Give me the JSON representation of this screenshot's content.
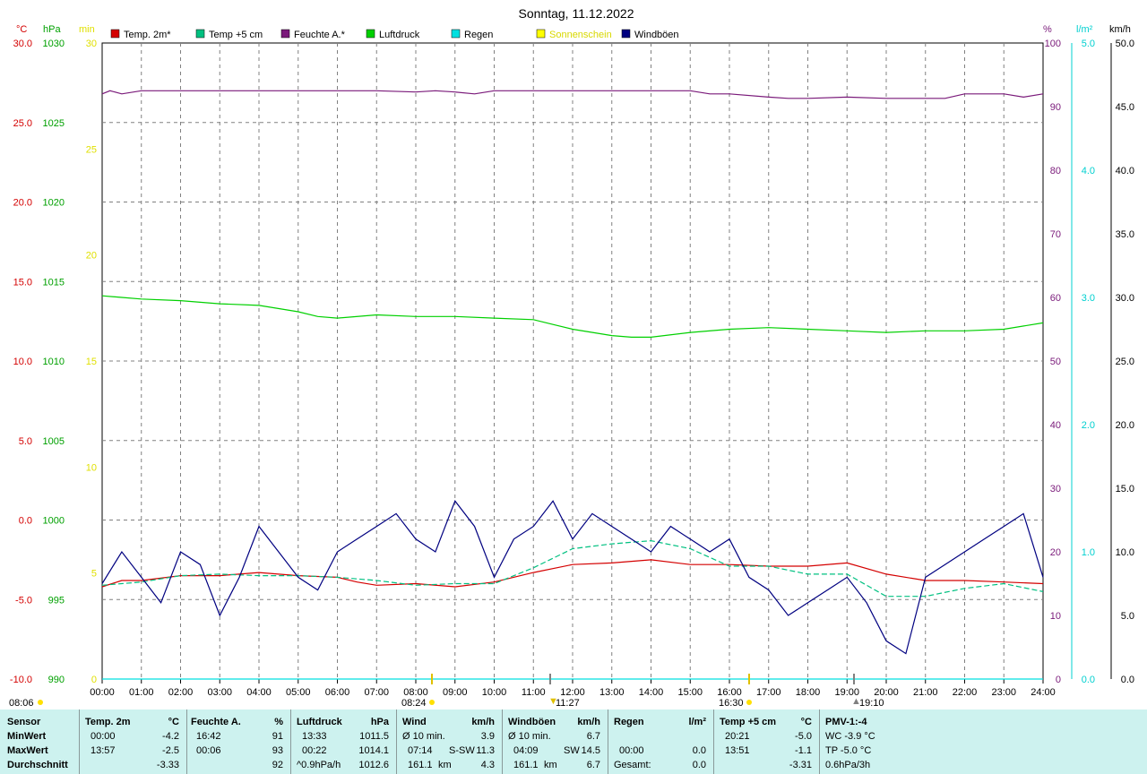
{
  "title": "Sonntag, 11.12.2022",
  "colors": {
    "temp2m": "#d40000",
    "temp5cm": "#00c080",
    "feuchte": "#7a1a7a",
    "luftdruck": "#00d000",
    "regen": "#00e0e0",
    "sonnenschein": "#ffff00",
    "windboeen": "#000080",
    "grid": "#808080",
    "panel": "#cdf2ef"
  },
  "axes": {
    "left_temp": {
      "unit": "°C",
      "ticks": [
        "30.0",
        "25.0",
        "20.0",
        "15.0",
        "10.0",
        "5.0",
        "0.0",
        "-5.0",
        "-10.0"
      ],
      "min": -10,
      "max": 30
    },
    "left_hpa": {
      "unit": "hPa",
      "ticks": [
        "1030",
        "1025",
        "1020",
        "1015",
        "1010",
        "1005",
        "1000",
        "995",
        "990"
      ],
      "min": 990,
      "max": 1030
    },
    "left_min": {
      "unit": "min",
      "ticks": [
        "30",
        "25",
        "20",
        "15",
        "10",
        "5",
        "0"
      ],
      "min": 0,
      "max": 30
    },
    "right_pct": {
      "unit": "%",
      "ticks": [
        "100",
        "90",
        "80",
        "70",
        "60",
        "50",
        "40",
        "30",
        "20",
        "10",
        "0"
      ],
      "min": 0,
      "max": 100
    },
    "right_rain": {
      "unit": "l/m²",
      "ticks": [
        "5.0",
        "4.0",
        "3.0",
        "2.0",
        "1.0",
        "0.0"
      ],
      "min": 0,
      "max": 5
    },
    "right_wind": {
      "unit": "km/h",
      "ticks": [
        "50.0",
        "45.0",
        "40.0",
        "35.0",
        "30.0",
        "25.0",
        "20.0",
        "15.0",
        "10.0",
        "5.0",
        "0.0"
      ],
      "min": 0,
      "max": 50
    },
    "x_ticks": [
      "00:00",
      "01:00",
      "02:00",
      "03:00",
      "04:00",
      "05:00",
      "06:00",
      "07:00",
      "08:00",
      "09:00",
      "10:00",
      "11:00",
      "12:00",
      "13:00",
      "14:00",
      "15:00",
      "16:00",
      "17:00",
      "18:00",
      "19:00",
      "20:00",
      "21:00",
      "22:00",
      "23:00",
      "24:00"
    ]
  },
  "legend": [
    {
      "label": "Temp. 2m*",
      "color": "#d40000"
    },
    {
      "label": "Temp +5 cm",
      "color": "#00c080"
    },
    {
      "label": "Feuchte A.*",
      "color": "#7a1a7a"
    },
    {
      "label": "Luftdruck",
      "color": "#00d000"
    },
    {
      "label": "Regen",
      "color": "#00e0e0"
    },
    {
      "label": "Sonnenschein",
      "color": "#ffff00"
    },
    {
      "label": "Windböen",
      "color": "#000080"
    }
  ],
  "sun_labels": {
    "sunrise_bottom": "08:06",
    "sunrise": "08:24",
    "noon": "11:27",
    "sunset": "16:30",
    "moon": "19:10"
  },
  "chart_data": {
    "type": "line",
    "title": "Sonntag, 11.12.2022",
    "x_unit": "hours",
    "xlim": [
      0,
      24
    ],
    "series": [
      {
        "name": "Temp. 2m*",
        "axis": "°C",
        "x": [
          0,
          0.5,
          1,
          2,
          3,
          4,
          5,
          6,
          6.5,
          7,
          8,
          9,
          10,
          11,
          12,
          13,
          14,
          15,
          16,
          17,
          18,
          19,
          20,
          21,
          22,
          23,
          24
        ],
        "values": [
          -4.2,
          -3.8,
          -3.8,
          -3.5,
          -3.5,
          -3.3,
          -3.5,
          -3.6,
          -3.9,
          -4.1,
          -4.0,
          -4.2,
          -3.9,
          -3.3,
          -2.8,
          -2.7,
          -2.5,
          -2.8,
          -2.8,
          -2.9,
          -2.9,
          -2.7,
          -3.4,
          -3.8,
          -3.8,
          -3.9,
          -4.0
        ]
      },
      {
        "name": "Temp +5 cm",
        "axis": "°C",
        "x": [
          0,
          0.5,
          1,
          2,
          3,
          4,
          5,
          6,
          7,
          8,
          9,
          10,
          11,
          12,
          13,
          14,
          15,
          16,
          17,
          18,
          19,
          20,
          21,
          22,
          23,
          24
        ],
        "values": [
          -4.1,
          -4.0,
          -3.9,
          -3.5,
          -3.4,
          -3.5,
          -3.5,
          -3.6,
          -3.8,
          -4.1,
          -4.0,
          -4.0,
          -3.0,
          -1.8,
          -1.5,
          -1.3,
          -1.8,
          -2.9,
          -2.9,
          -3.4,
          -3.4,
          -4.8,
          -4.8,
          -4.3,
          -4.0,
          -4.5
        ]
      },
      {
        "name": "Feuchte A.*",
        "axis": "%",
        "x": [
          0,
          0.2,
          0.5,
          1,
          2,
          3,
          4,
          5,
          6,
          7,
          8,
          8.5,
          9,
          9.5,
          10,
          11,
          12,
          13,
          14,
          15,
          15.5,
          16,
          17,
          17.5,
          18,
          19,
          20,
          21,
          21.5,
          22,
          22.5,
          23,
          23.5,
          24
        ],
        "values": [
          92,
          92.5,
          92,
          92.5,
          92.5,
          92.5,
          92.5,
          92.5,
          92.5,
          92.5,
          92.3,
          92.5,
          92.3,
          92,
          92.5,
          92.5,
          92.5,
          92.5,
          92.5,
          92.5,
          92,
          92,
          91.5,
          91.3,
          91.3,
          91.5,
          91.3,
          91.3,
          91.3,
          92,
          92,
          92,
          91.5,
          92
        ]
      },
      {
        "name": "Luftdruck",
        "axis": "hPa",
        "x": [
          0,
          0.5,
          1,
          2,
          3,
          4,
          5,
          5.5,
          6,
          7,
          8,
          9,
          10,
          11,
          11.5,
          12,
          13,
          13.5,
          14,
          15,
          16,
          17,
          18,
          19,
          20,
          21,
          22,
          23,
          24
        ],
        "values": [
          1014.1,
          1014.0,
          1013.9,
          1013.8,
          1013.6,
          1013.5,
          1013.1,
          1012.8,
          1012.7,
          1012.9,
          1012.8,
          1012.8,
          1012.7,
          1012.6,
          1012.3,
          1012.0,
          1011.6,
          1011.5,
          1011.5,
          1011.8,
          1012.0,
          1012.1,
          1012.0,
          1011.9,
          1011.8,
          1011.9,
          1011.9,
          1012.0,
          1012.4
        ]
      },
      {
        "name": "Regen",
        "axis": "l/m²",
        "x": [
          0,
          24
        ],
        "values": [
          0,
          0
        ]
      },
      {
        "name": "Windböen",
        "axis": "km/h",
        "x": [
          0,
          0.5,
          1,
          1.5,
          2,
          2.5,
          3,
          3.5,
          4,
          4.5,
          5,
          5.5,
          6,
          6.5,
          7,
          7.5,
          8,
          8.5,
          9,
          9.5,
          10,
          10.5,
          11,
          11.5,
          12,
          12.5,
          13,
          13.5,
          14,
          14.5,
          15,
          15.5,
          16,
          16.5,
          17,
          17.5,
          18,
          18.5,
          19,
          19.5,
          20,
          20.5,
          21,
          21.5,
          22,
          22.5,
          23,
          23.5,
          24
        ],
        "values": [
          7.5,
          10,
          8,
          6,
          10,
          9,
          5,
          8,
          12,
          10,
          8,
          7,
          10,
          11,
          12,
          13,
          11,
          10,
          14,
          12,
          8,
          11,
          12,
          14,
          11,
          13,
          12,
          11,
          10,
          12,
          11,
          10,
          11,
          8,
          7,
          5,
          6,
          7,
          8,
          6,
          3,
          2,
          8,
          9,
          10,
          11,
          12,
          13,
          8
        ]
      }
    ]
  },
  "stats": {
    "headers": {
      "sensor": "Sensor",
      "temp2m": "Temp. 2m",
      "temp2m_unit": "°C",
      "feuchte": "Feuchte A.",
      "feuchte_unit": "%",
      "luft": "Luftdruck",
      "luft_unit": "hPa",
      "wind": "Wind",
      "wind_unit": "km/h",
      "boeen": "Windböen",
      "boeen_unit": "km/h",
      "regen": "Regen",
      "regen_unit": "l/m²",
      "temp5": "Temp +5 cm",
      "temp5_unit": "°C",
      "pmv": "PMV-1:-4"
    },
    "rows": [
      {
        "label": "MinWert",
        "t2m_time": "00:00",
        "t2m_val": "-4.2",
        "f_time": "16:42",
        "f_val": "91",
        "l_time": "13:33",
        "l_val": "1011.5",
        "w_a": "Ø 10 min.",
        "w_b": "",
        "w_val": "3.9",
        "b_a": "Ø 10 min.",
        "b_b": "",
        "b_val": "6.7",
        "r_a": "",
        "r_val": "",
        "t5_time": "20:21",
        "t5_val": "-5.0",
        "pmv": "WC -3.9 °C"
      },
      {
        "label": "MaxWert",
        "t2m_time": "13:57",
        "t2m_val": "-2.5",
        "f_time": "00:06",
        "f_val": "93",
        "l_time": "00:22",
        "l_val": "1014.1",
        "w_a": "07:14",
        "w_b": "S-SW",
        "w_val": "11.3",
        "b_a": "04:09",
        "b_b": "SW",
        "b_val": "14.5",
        "r_a": "00:00",
        "r_val": "0.0",
        "t5_time": "13:51",
        "t5_val": "-1.1",
        "pmv": "TP -5.0 °C"
      },
      {
        "label": "Durchschnitt",
        "t2m_time": "",
        "t2m_val": "-3.33",
        "f_time": "",
        "f_val": "92",
        "l_time": "^0.9hPa/h",
        "l_val": "1012.6",
        "w_a": "161.1",
        "w_b": "km",
        "w_val": "4.3",
        "b_a": "161.1",
        "b_b": "km",
        "b_val": "6.7",
        "r_a": "Gesamt:",
        "r_val": "0.0",
        "t5_time": "",
        "t5_val": "-3.31",
        "pmv": "0.6hPa/3h"
      }
    ]
  }
}
